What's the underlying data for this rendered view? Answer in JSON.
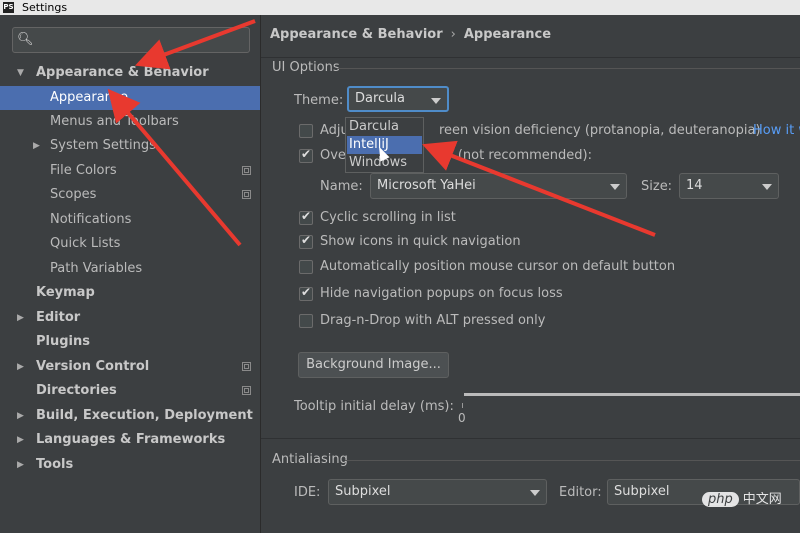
{
  "window": {
    "title": "Settings",
    "app_icon": "PS"
  },
  "search": {
    "placeholder": "",
    "value": ""
  },
  "sidebar": {
    "items": [
      {
        "label": "Appearance & Behavior",
        "expanded": true
      },
      {
        "label": "Appearance"
      },
      {
        "label": "Menus and Toolbars"
      },
      {
        "label": "System Settings"
      },
      {
        "label": "File Colors"
      },
      {
        "label": "Scopes"
      },
      {
        "label": "Notifications"
      },
      {
        "label": "Quick Lists"
      },
      {
        "label": "Path Variables"
      },
      {
        "label": "Keymap"
      },
      {
        "label": "Editor"
      },
      {
        "label": "Plugins"
      },
      {
        "label": "Version Control"
      },
      {
        "label": "Directories"
      },
      {
        "label": "Build, Execution, Deployment"
      },
      {
        "label": "Languages & Frameworks"
      },
      {
        "label": "Tools"
      }
    ]
  },
  "breadcrumb": {
    "parent": "Appearance & Behavior",
    "sep": "›",
    "current": "Appearance"
  },
  "ui_options": {
    "title": "UI Options",
    "theme_label": "Theme:",
    "theme_value": "Darcula",
    "theme_options": [
      "Darcula",
      "IntelliJ",
      "Windows"
    ],
    "adjust_label": "Adjust colors for red-green vision deficiency (protanopia, deuteranopia)",
    "adjust_visible_prefix": "Adju",
    "adjust_visible_suffix": "reen vision deficiency (protanopia, deuteranopia)",
    "how_link": "How it w",
    "override_prefix": "Over",
    "override_suffix": "y (not recommended):",
    "name_label": "Name:",
    "name_value": "Microsoft YaHei",
    "size_label": "Size:",
    "size_value": "14",
    "cyclic_label": "Cyclic scrolling in list",
    "show_icons_label": "Show icons in quick navigation",
    "auto_cursor_label": "Automatically position mouse cursor on default button",
    "hide_popups_label": "Hide navigation popups on focus loss",
    "drag_drop_label": "Drag-n-Drop with ALT pressed only",
    "bg_button": "Background Image...",
    "tooltip_label": "Tooltip initial delay (ms):",
    "tooltip_tick0": "0"
  },
  "checkboxes": {
    "adjust": false,
    "override": true,
    "cyclic": true,
    "show_icons": true,
    "auto_cursor": false,
    "hide_popups": true,
    "drag_drop": false
  },
  "antialiasing": {
    "title": "Antialiasing",
    "ide_label": "IDE:",
    "ide_value": "Subpixel",
    "editor_label": "Editor:",
    "editor_value": "Subpixel"
  },
  "watermark": {
    "logo": "php",
    "text": "中文网"
  },
  "colors": {
    "selection": "#4b6eaf",
    "annotation_arrow": "#e8392f",
    "background": "#3c3f41"
  }
}
